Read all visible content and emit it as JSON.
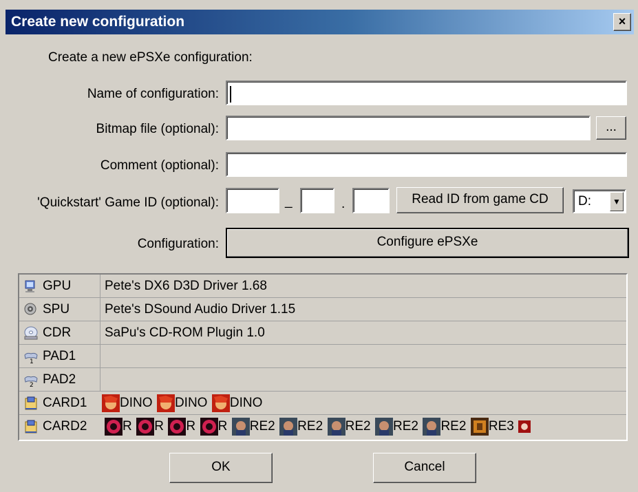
{
  "window": {
    "title": "Create new configuration",
    "close_glyph": "×"
  },
  "form": {
    "intro": "Create a new ePSXe configuration:",
    "name_label": "Name of configuration:",
    "name_value": "",
    "bitmap_label": "Bitmap file (optional):",
    "bitmap_value": "",
    "browse_label": "...",
    "comment_label": "Comment (optional):",
    "comment_value": "",
    "gameid_label": "'Quickstart' Game ID (optional):",
    "gameid_part1": "",
    "gameid_sep1": "_",
    "gameid_part2": "",
    "gameid_sep2": ".",
    "gameid_part3": "",
    "read_id_button": "Read ID from game CD",
    "drive_selected": "D:",
    "configuration_label": "Configuration:",
    "configure_button": "Configure ePSXe"
  },
  "plugins": [
    {
      "name": "GPU",
      "desc": "Pete's DX6 D3D Driver 1.68",
      "icon": "monitor-icon"
    },
    {
      "name": "SPU",
      "desc": "Pete's DSound Audio Driver 1.15",
      "icon": "speaker-icon"
    },
    {
      "name": "CDR",
      "desc": "SaPu's CD-ROM Plugin 1.0",
      "icon": "cdrom-icon"
    },
    {
      "name": "PAD1",
      "desc": "",
      "icon": "gamepad-1-icon"
    },
    {
      "name": "PAD2",
      "desc": "",
      "icon": "gamepad-2-icon"
    }
  ],
  "cards": [
    {
      "name": "CARD1",
      "icon": "memory-card-icon",
      "items": [
        "DINO",
        "DINO",
        "DINO"
      ]
    },
    {
      "name": "CARD2",
      "icon": "memory-card-icon",
      "items": [
        "R",
        "R",
        "R",
        "R",
        "RE2",
        "RE2",
        "RE2",
        "RE2",
        "RE2",
        "RE3",
        ""
      ]
    }
  ],
  "buttons": {
    "ok": "OK",
    "cancel": "Cancel"
  },
  "colors": {
    "face": "#d4d0c8",
    "title_start": "#0a246a",
    "title_end": "#a6caf0"
  }
}
